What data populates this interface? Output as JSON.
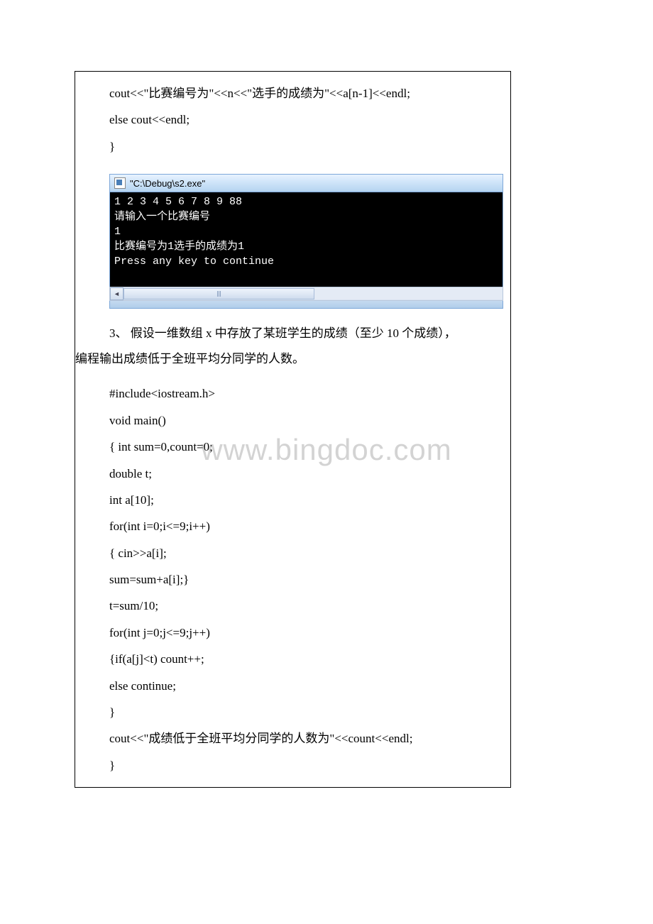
{
  "code_top": {
    "line1": "cout<<\"比赛编号为\"<<n<<\"选手的成绩为\"<<a[n-1]<<endl;",
    "line2": "else cout<<endl;",
    "line3": "}"
  },
  "console": {
    "title": "\"C:\\Debug\\s2.exe\"",
    "output": "1 2 3 4 5 6 7 8 9 88\n请输入一个比赛编号\n1\n比赛编号为1选手的成绩为1\nPress any key to continue"
  },
  "question": {
    "number": "3、",
    "text_line1": "假设一维数组 x 中存放了某班学生的成绩（至少 10 个成绩），",
    "text_line2": "编程输出成绩低于全班平均分同学的人数。"
  },
  "code_bottom": {
    "l1": "#include<iostream.h>",
    "l2": "void main()",
    "l3": "{ int sum=0,count=0;",
    "l4": " double t;",
    "l5": " int a[10];",
    "l6": " for(int i=0;i<=9;i++)",
    "l7": " { cin>>a[i];",
    "l8": " sum=sum+a[i];}",
    "l9": " t=sum/10;",
    "l10": " for(int j=0;j<=9;j++)",
    "l11": " {if(a[j]<t) count++;",
    "l12": " else continue;",
    "l13": " }",
    "l14": " cout<<\"成绩低于全班平均分同学的人数为\"<<count<<endl;",
    "l15": " }"
  },
  "watermark": "www.bingdoc.com"
}
